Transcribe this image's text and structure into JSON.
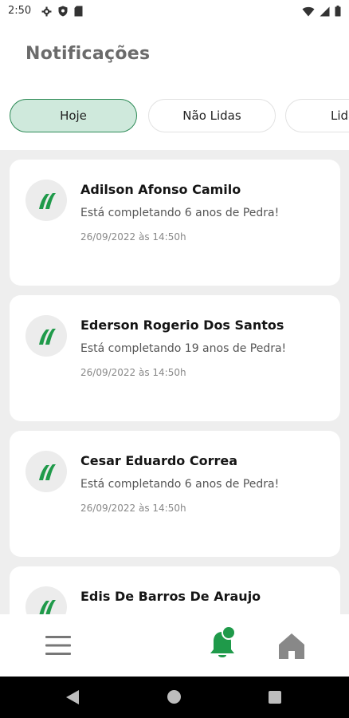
{
  "status_bar": {
    "time": "2:50",
    "left_icons": [
      "gear-icon",
      "shield-icon",
      "sd-card-icon"
    ],
    "right_icons": [
      "wifi-icon",
      "signal-icon",
      "battery-icon"
    ]
  },
  "header": {
    "title": "Notificações"
  },
  "tabs": [
    {
      "label": "Hoje",
      "active": true
    },
    {
      "label": "Não Lidas",
      "active": false
    },
    {
      "label": "Lidas",
      "active": false
    }
  ],
  "notifications": [
    {
      "name": "Adilson Afonso Camilo",
      "message": "Está completando 6 anos de Pedra!",
      "date": "26/09/2022 às 14:50h"
    },
    {
      "name": "Ederson Rogerio Dos Santos",
      "message": "Está completando 19 anos de Pedra!",
      "date": "26/09/2022 às 14:50h"
    },
    {
      "name": "Cesar Eduardo Correa",
      "message": "Está completando 6 anos de Pedra!",
      "date": "26/09/2022 às 14:50h"
    },
    {
      "name": "Edis De Barros De Araujo",
      "message": "",
      "date": ""
    }
  ],
  "bottom_nav": {
    "items": [
      "menu-icon",
      "bell-icon",
      "home-icon"
    ],
    "active": "bell-icon"
  },
  "colors": {
    "brand_green": "#1f9a4a",
    "tab_active_bg": "#cfe9dc",
    "tab_active_border": "#2e8b57",
    "list_bg": "#eeeeee",
    "title_gray": "#6b6b6b"
  }
}
